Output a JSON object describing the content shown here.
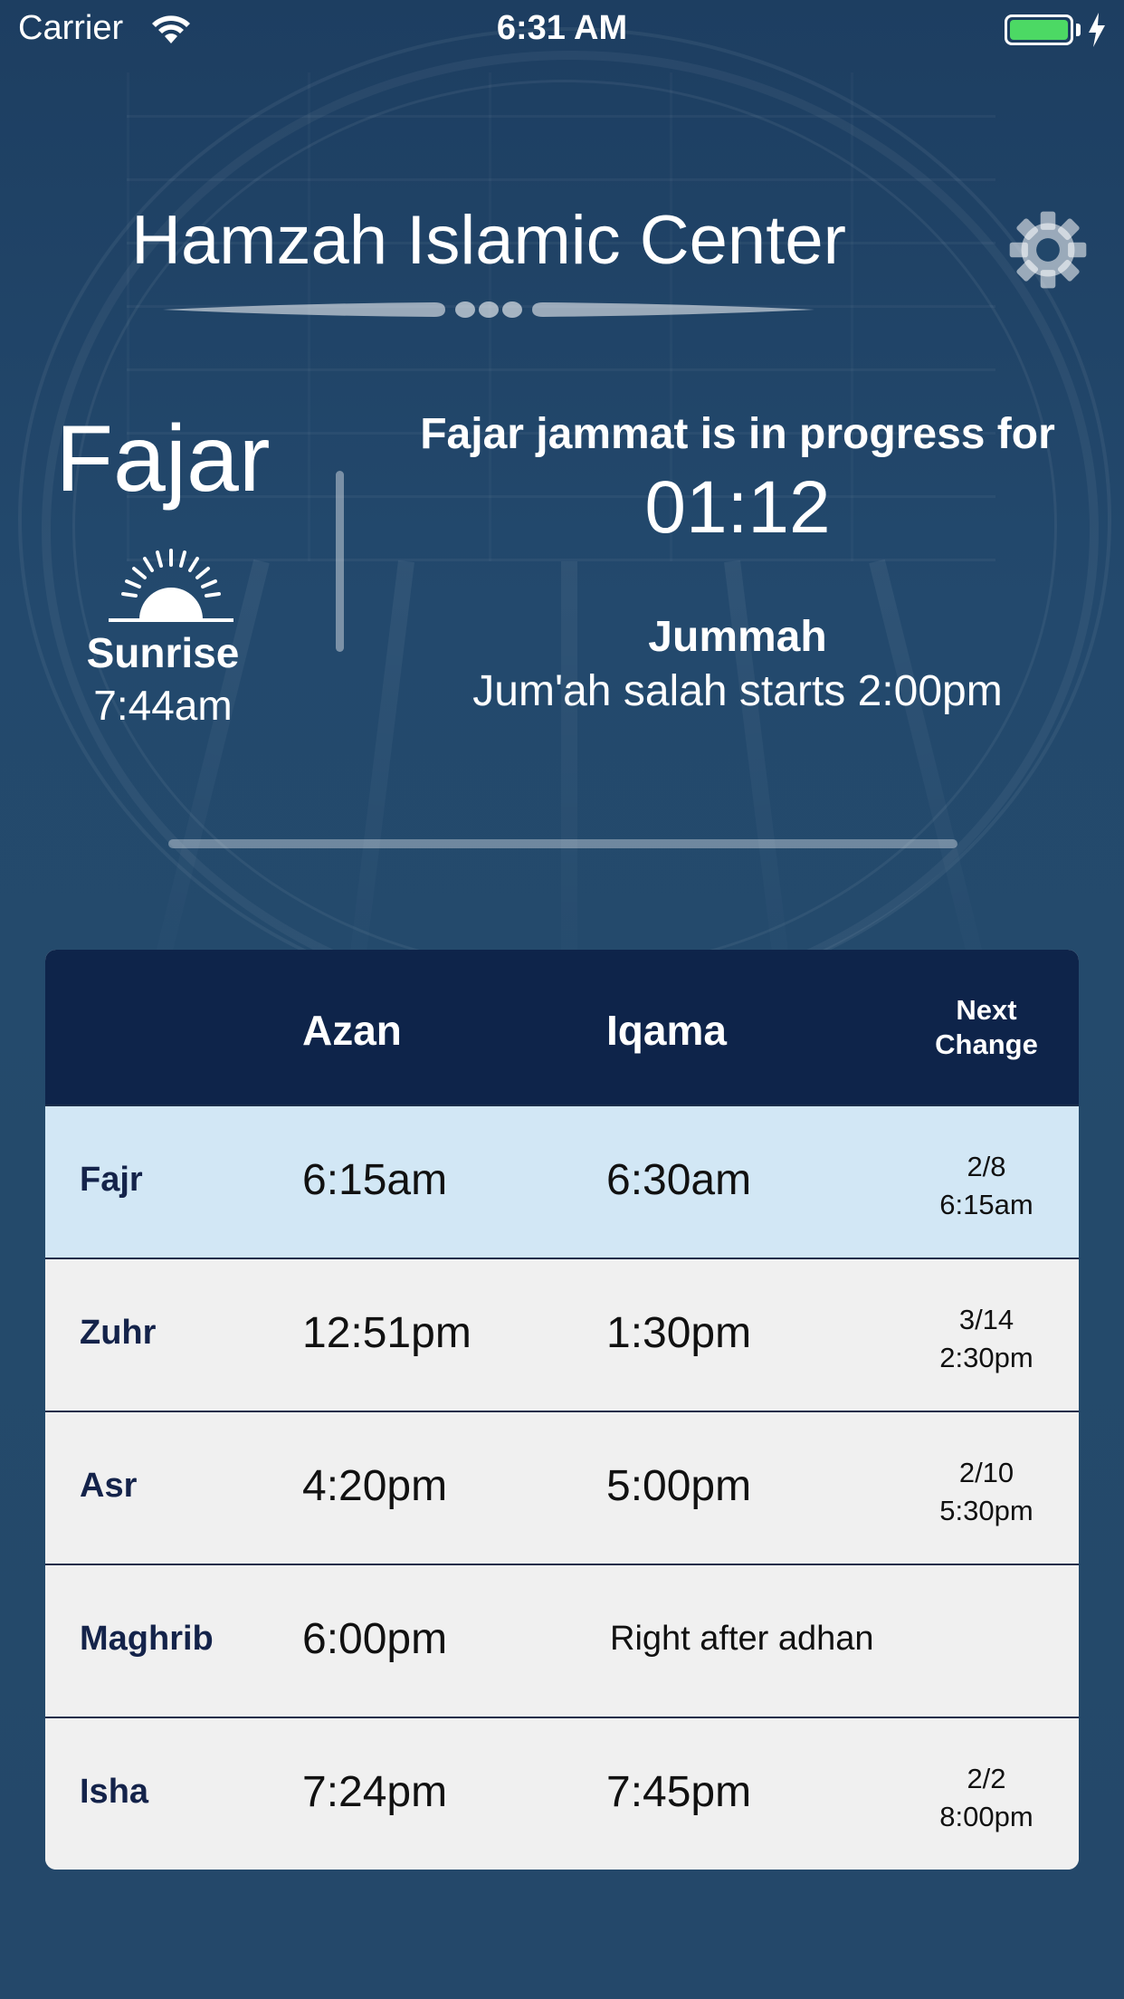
{
  "status_bar": {
    "carrier": "Carrier",
    "time": "6:31 AM",
    "battery_color": "#4cd964"
  },
  "header": {
    "title": "Hamzah Islamic Center",
    "settings_icon": "gear-icon"
  },
  "current": {
    "prayer": "Fajar",
    "sunrise_icon": "sunrise-icon",
    "sunrise_label": "Sunrise",
    "sunrise_time": "7:44am",
    "progress_text": "Fajar jammat is in progress for",
    "countdown": "01:12",
    "jummah_title": "Jummah",
    "jummah_text": "Jum'ah salah starts 2:00pm"
  },
  "table": {
    "headers": {
      "name": "",
      "azan": "Azan",
      "iqama": "Iqama",
      "next_line1": "Next",
      "next_line2": "Change"
    },
    "header_color": "#0e244a",
    "highlight_color": "#d2e7f5",
    "rows": [
      {
        "name": "Fajr",
        "azan": "6:15am",
        "iqama": "6:30am",
        "next_date": "2/8",
        "next_time": "6:15am",
        "highlighted": true
      },
      {
        "name": "Zuhr",
        "azan": "12:51pm",
        "iqama": "1:30pm",
        "next_date": "3/14",
        "next_time": "2:30pm"
      },
      {
        "name": "Asr",
        "azan": "4:20pm",
        "iqama": "5:00pm",
        "next_date": "2/10",
        "next_time": "5:30pm"
      },
      {
        "name": "Maghrib",
        "azan": "6:00pm",
        "iqama": "Right after adhan",
        "next_date": "",
        "next_time": ""
      },
      {
        "name": "Isha",
        "azan": "7:24pm",
        "iqama": "7:45pm",
        "next_date": "2/2",
        "next_time": "8:00pm"
      }
    ]
  }
}
